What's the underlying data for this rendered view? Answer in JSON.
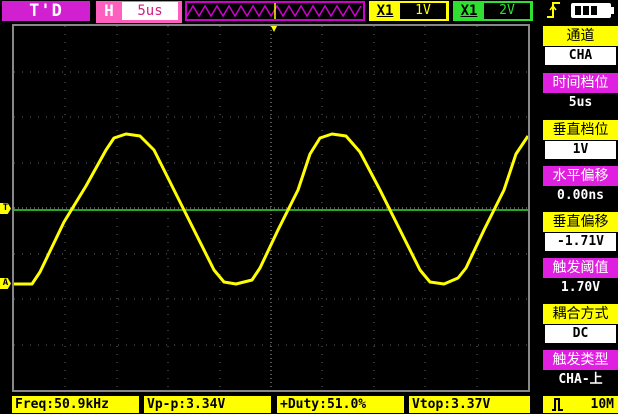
{
  "header": {
    "mode": "T'D",
    "timebase_tag": "H",
    "timebase": "5us",
    "cha_tag": "X1",
    "cha_scale": "1V",
    "chb_tag": "X1",
    "chb_scale": "2V",
    "trigger_edge_icon": "rising-edge-icon",
    "battery_level_percent": 60
  },
  "menu": [
    {
      "title": "通道",
      "value": "CHA",
      "title_color": "#ffff00"
    },
    {
      "title": "时间档位",
      "value": "5us",
      "title_color": "#e020e0"
    },
    {
      "title": "垂直档位",
      "value": "1V",
      "title_color": "#ffff00"
    },
    {
      "title": "水平偏移",
      "value": "0.00ns",
      "title_color": "#e020e0"
    },
    {
      "title": "垂直偏移",
      "value": "-1.71V",
      "title_color": "#ffff00"
    },
    {
      "title": "触发阈值",
      "value": "1.70V",
      "title_color": "#e020e0"
    },
    {
      "title": "耦合方式",
      "value": "DC",
      "title_color": "#ffff00"
    },
    {
      "title": "触发类型",
      "value": "CHA-上",
      "title_color": "#e020e0"
    }
  ],
  "markers": {
    "trigger": "T",
    "channel_a": "A"
  },
  "measurements": {
    "freq": "Freq:50.9kHz",
    "vpp": "Vp-p:3.34V",
    "duty": "+Duty:51.0%",
    "vtop": "Vtop:3.37V"
  },
  "trigger_status": {
    "label": "10M"
  },
  "colors": {
    "cha": "#ffff00",
    "chb": "#30e030",
    "accent": "#e020e0",
    "grid": "#666666"
  }
}
